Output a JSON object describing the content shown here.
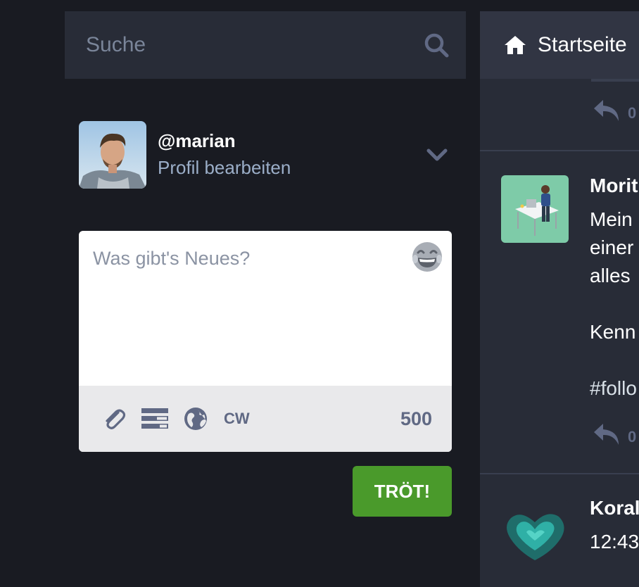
{
  "search": {
    "placeholder": "Suche"
  },
  "account": {
    "handle": "@marian",
    "edit_label": "Profil bearbeiten"
  },
  "compose": {
    "placeholder": "Was gibt's Neues?",
    "cw_label": "CW",
    "char_count": "500",
    "submit_label": "TRÖT!"
  },
  "column": {
    "title": "Startseite",
    "items": [
      {
        "reply_count": "0"
      },
      {
        "name": "Morit",
        "lines": [
          "Mein",
          "einer",
          "alles",
          "",
          "Kenn"
        ],
        "tag": "#follo",
        "reply_count": "0"
      },
      {
        "name": "Koral",
        "time": "12:43"
      }
    ]
  },
  "colors": {
    "background": "#191b22",
    "panel": "#282c37",
    "accent_button": "#4a9a2b",
    "muted": "#606984",
    "link": "#9baec8"
  }
}
